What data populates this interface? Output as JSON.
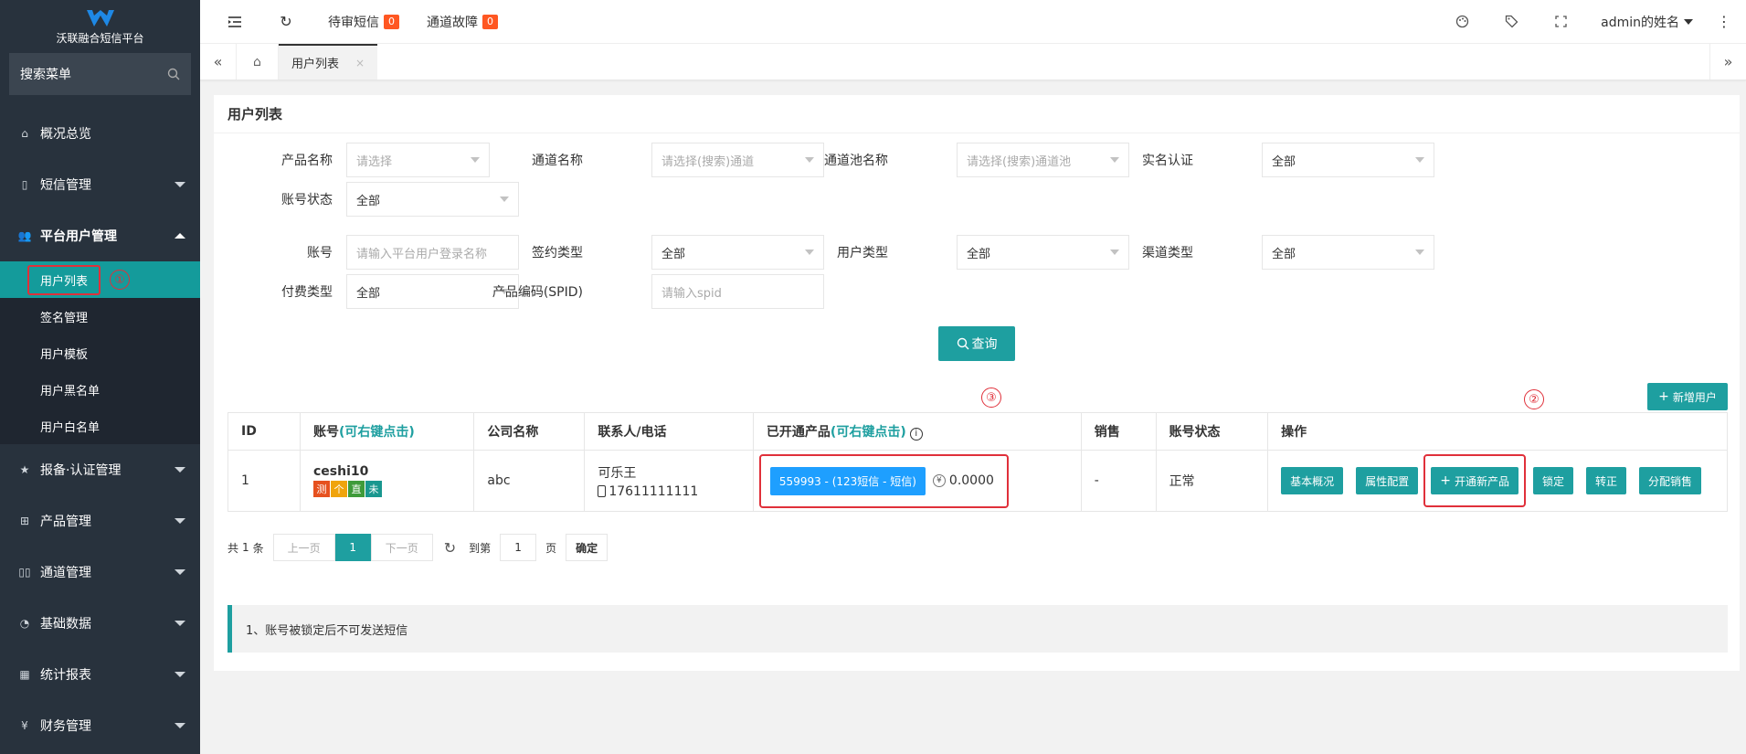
{
  "sidebar": {
    "logo_text": "沃联融合短信平台",
    "search_placeholder": "搜索菜单",
    "menu": [
      {
        "label": "概况总览",
        "icon": "home-icon"
      },
      {
        "label": "短信管理",
        "icon": "phone-icon"
      },
      {
        "label": "平台用户管理",
        "icon": "users-icon"
      },
      {
        "label": "报备·认证管理",
        "icon": "star-icon"
      },
      {
        "label": "产品管理",
        "icon": "grid-icon"
      },
      {
        "label": "通道管理",
        "icon": "columns-icon"
      },
      {
        "label": "基础数据",
        "icon": "dashboard-icon"
      },
      {
        "label": "统计报表",
        "icon": "table-icon"
      },
      {
        "label": "财务管理",
        "icon": "yen-icon"
      }
    ],
    "submenu": [
      {
        "label": "用户列表"
      },
      {
        "label": "签名管理"
      },
      {
        "label": "用户模板"
      },
      {
        "label": "用户黑名单"
      },
      {
        "label": "用户白名单"
      }
    ]
  },
  "topbar": {
    "pending_sms": "待审短信",
    "pending_count": "0",
    "channel_fault": "通道故障",
    "fault_count": "0",
    "user_name": "admin的姓名"
  },
  "tabs": {
    "active": "用户列表",
    "close": "×"
  },
  "page": {
    "title": "用户列表",
    "annotations": [
      "①",
      "②",
      "③"
    ]
  },
  "filters": {
    "product_name": {
      "label": "产品名称",
      "placeholder": "请选择"
    },
    "channel_name": {
      "label": "通道名称",
      "placeholder": "请选择(搜索)通道"
    },
    "channel_pool": {
      "label": "通道池名称",
      "placeholder": "请选择(搜索)通道池"
    },
    "realname": {
      "label": "实名认证",
      "value": "全部"
    },
    "account_status": {
      "label": "账号状态",
      "value": "全部"
    },
    "account": {
      "label": "账号",
      "placeholder": "请输入平台用户登录名称"
    },
    "sign_type": {
      "label": "签约类型",
      "value": "全部"
    },
    "user_type": {
      "label": "用户类型",
      "value": "全部"
    },
    "channel_type": {
      "label": "渠道类型",
      "value": "全部"
    },
    "pay_type": {
      "label": "付费类型",
      "value": "全部"
    },
    "spid": {
      "label": "产品编码(SPID)",
      "placeholder": "请输入spid"
    },
    "query_button": "查询",
    "add_user_button": "新增用户"
  },
  "table": {
    "headers": {
      "id": "ID",
      "account": "账号",
      "account_hint": "(可右键点击)",
      "company": "公司名称",
      "contact": "联系人/电话",
      "products": "已开通产品",
      "products_hint": "(可右键点击)",
      "sales": "销售",
      "status": "账号状态",
      "ops": "操作"
    },
    "rows": [
      {
        "id": "1",
        "account": "ceshi10",
        "tags": [
          {
            "text": "测",
            "color": "#e6511f"
          },
          {
            "text": "个",
            "color": "#f0a40c"
          },
          {
            "text": "直",
            "color": "#3f9b3a"
          },
          {
            "text": "未",
            "color": "#19978f"
          }
        ],
        "company": "abc",
        "contact_name": "可乐王",
        "contact_phone": "17611111111",
        "product_chip": "559993 - (123短信 - 短信)",
        "balance": "0.0000",
        "sales": "-",
        "status": "正常",
        "ops": {
          "overview": "基本概况",
          "attr": "属性配置",
          "open_product": "开通新产品",
          "lock": "锁定",
          "regularize": "转正",
          "assign_sales": "分配销售"
        }
      }
    ]
  },
  "pager": {
    "total_prefix": "共",
    "total": "1",
    "total_suffix": "条",
    "prev": "上一页",
    "current": "1",
    "next": "下一页",
    "goto": "到第",
    "goto_page": "1",
    "page_unit": "页",
    "confirm": "确定"
  },
  "notice": "1、账号被锁定后不可发送短信",
  "colors": {
    "primary": "#1e9fa0",
    "sidebar_bg": "#28323d",
    "annotation_red": "#e0303a",
    "badge": "#ff5722",
    "chip_blue": "#1e9fff"
  }
}
